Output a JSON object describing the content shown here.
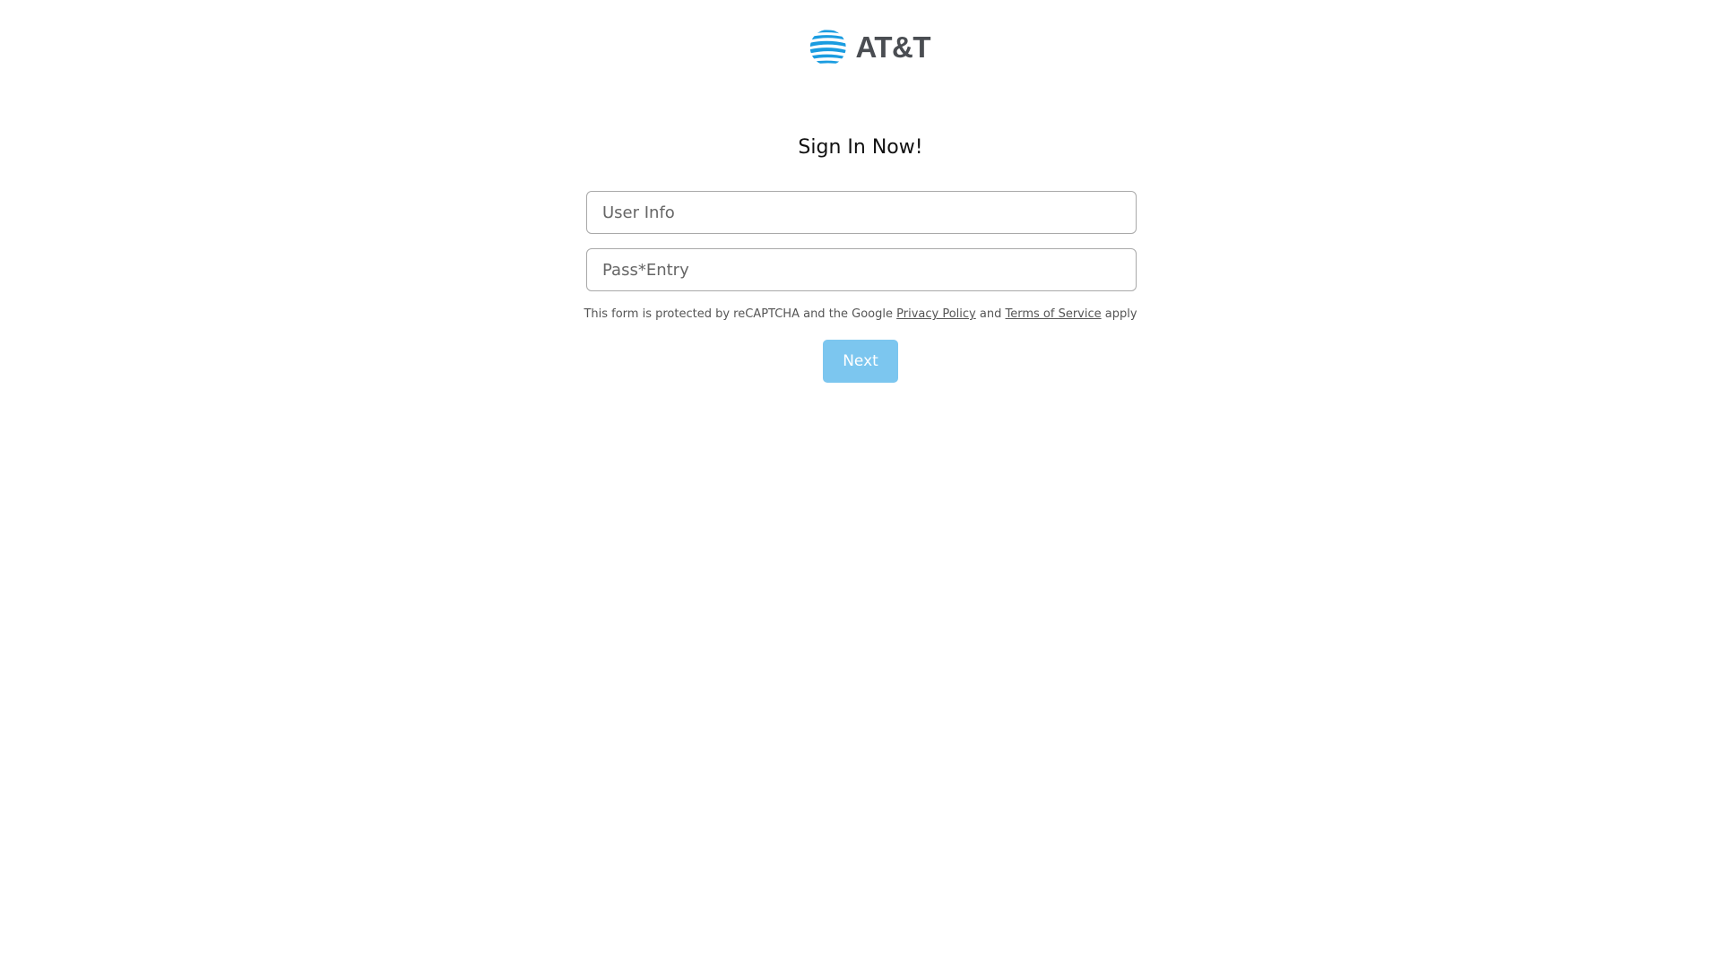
{
  "brand": {
    "logo_text": "AT&T",
    "logo_icon": "att-globe-icon",
    "globe_color": "#1a9ce0"
  },
  "form": {
    "title": "Sign In Now!",
    "user_placeholder": "User Info",
    "password_placeholder": "Pass*Entry",
    "recaptcha_prefix": "This form is protected by reCAPTCHA and the Google",
    "privacy_link": "Privacy Policy",
    "and_text": "and",
    "terms_link": "Terms of Service",
    "apply_text": "apply",
    "next_label": "Next"
  },
  "colors": {
    "button_bg": "#7cc6ef",
    "button_text": "#ffffff",
    "border": "#a9a9a9"
  }
}
